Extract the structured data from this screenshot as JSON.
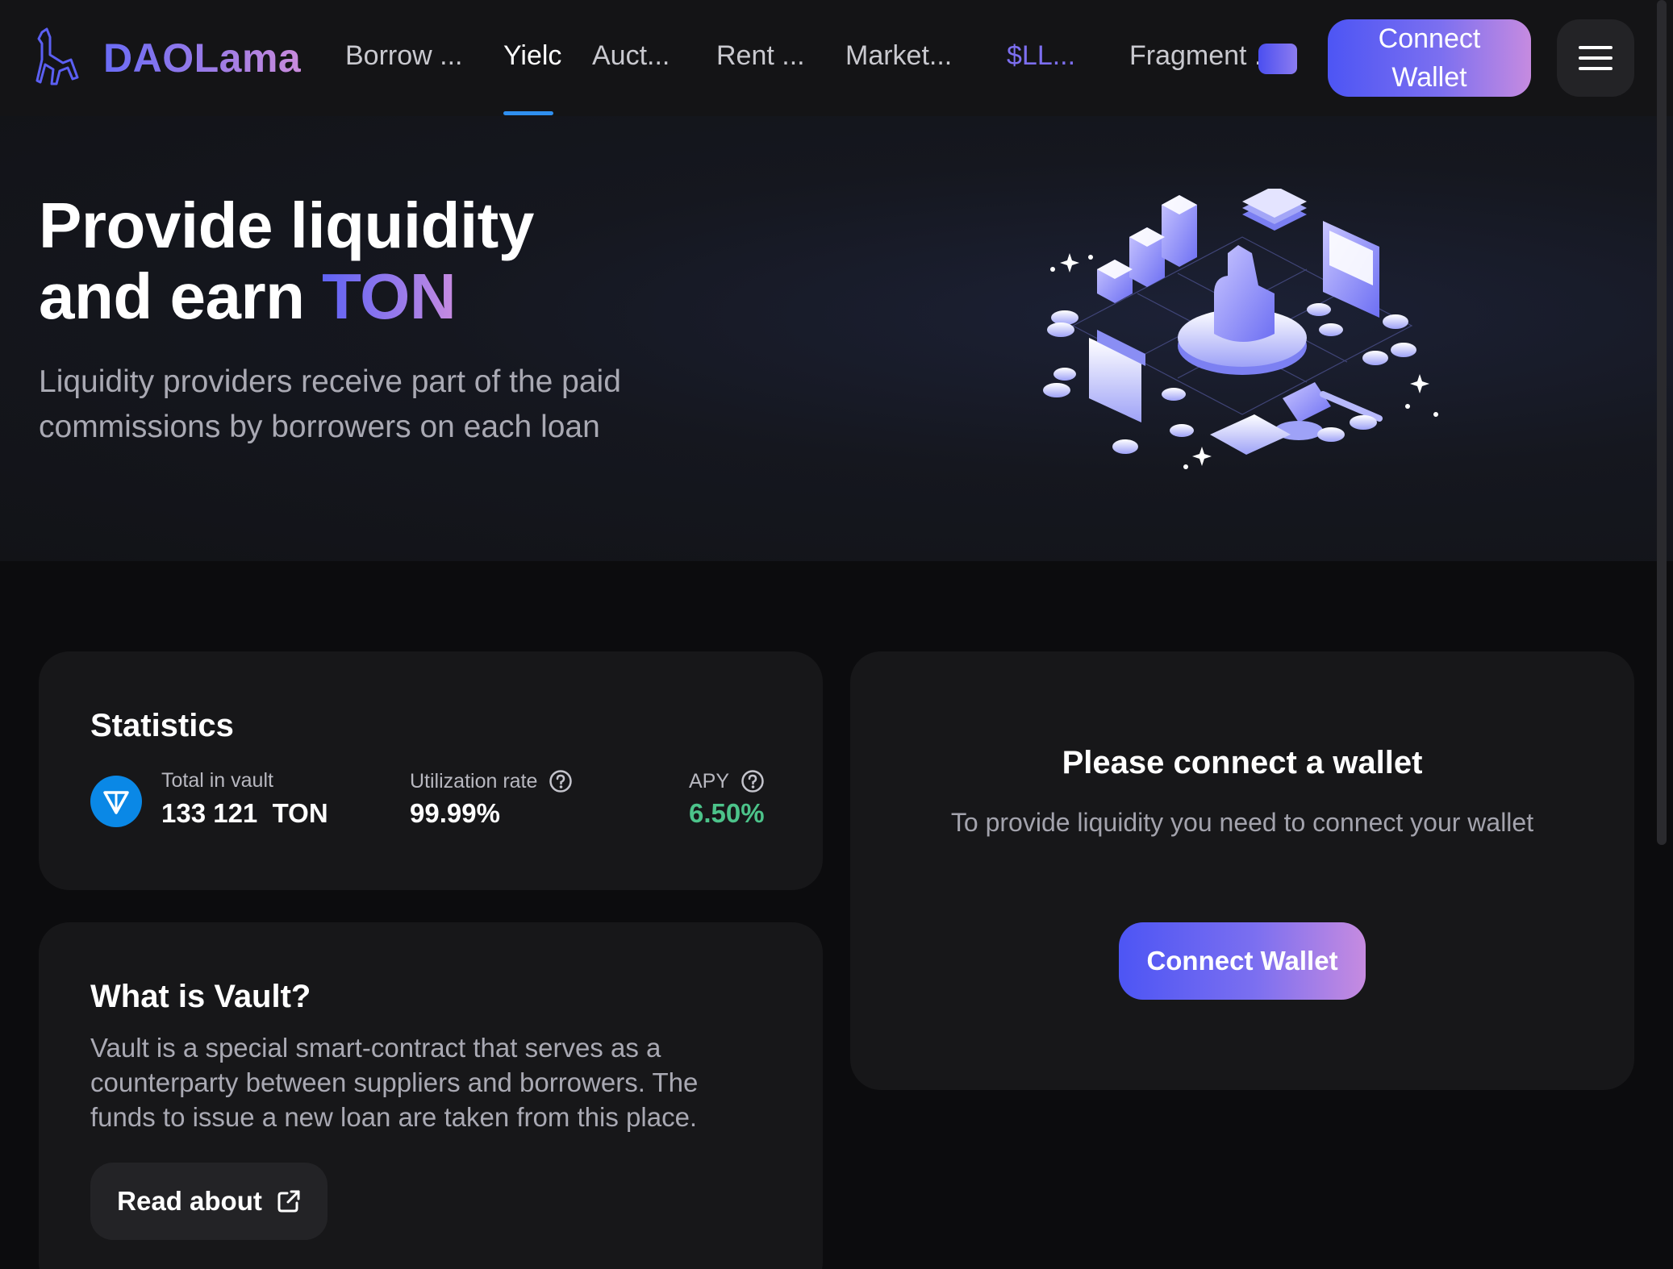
{
  "header": {
    "brand": "DAOLama",
    "nav": [
      {
        "label": "Borrow ...",
        "icon": ""
      },
      {
        "label": "Yielc",
        "active": true
      },
      {
        "label": "Auct..."
      },
      {
        "label": "Rent ..."
      },
      {
        "label": "Market..."
      },
      {
        "label": "$LL...",
        "accent": true
      },
      {
        "label": "Fragment ..."
      }
    ],
    "connect_label": "Connect Wallet",
    "menu_icon": "hamburger-icon"
  },
  "hero": {
    "title_line1": "Provide liquidity",
    "title_line2_prefix": "and earn ",
    "title_line2_highlight": "TON",
    "subtitle": "Liquidity providers receive part of the paid commissions by borrowers on each loan"
  },
  "stats": {
    "title": "Statistics",
    "total_label": "Total in vault",
    "total_value": "133 121  TON",
    "util_label": "Utilization rate",
    "util_value": "99.99%",
    "apy_label": "APY",
    "apy_value": "6.50%"
  },
  "wallet": {
    "title": "Please connect a wallet",
    "subtitle": "To provide liquidity you need to connect your wallet",
    "button": "Connect Wallet"
  },
  "vault": {
    "title": "What is Vault?",
    "text": "Vault is a special smart-contract that serves as a counterparty between suppliers and borrowers. The funds to issue a new loan are taken from this place.",
    "button": "Read about"
  },
  "colors": {
    "accent_start": "#4d55f4",
    "accent_end": "#c68be0",
    "positive": "#4cc38a",
    "nav_active_underline": "#2f8ff0",
    "ton_blue": "#0a88e6"
  }
}
